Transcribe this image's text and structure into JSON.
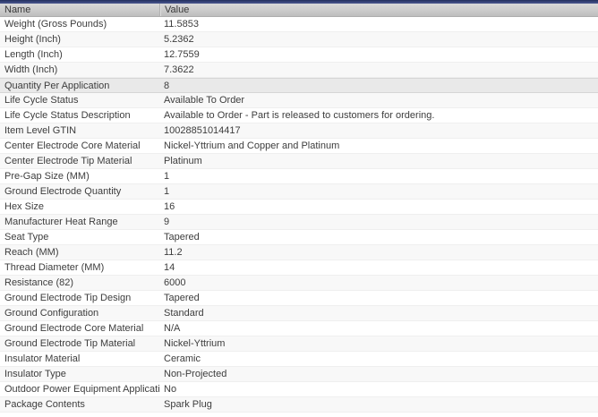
{
  "colors": {
    "topbar_dark": "#222f5e",
    "topbar_light": "#4a5790",
    "header_gradient_top": "#d8d8d8",
    "header_gradient_bottom": "#bdbdbd",
    "stripe": "#f8f8f8",
    "highlight": "#e9e9e9",
    "text": "#3d3d3d"
  },
  "table": {
    "columns": {
      "name": "Name",
      "value": "Value"
    },
    "selected_index": 4,
    "rows": [
      {
        "name": "Weight (Gross Pounds)",
        "value": "11.5853"
      },
      {
        "name": "Height (Inch)",
        "value": "5.2362"
      },
      {
        "name": "Length (Inch)",
        "value": "12.7559"
      },
      {
        "name": "Width (Inch)",
        "value": "7.3622"
      },
      {
        "name": "Quantity Per Application",
        "value": "8"
      },
      {
        "name": "Life Cycle Status",
        "value": "Available To Order"
      },
      {
        "name": "Life Cycle Status Description",
        "value": "Available to Order - Part is released to customers for ordering."
      },
      {
        "name": "Item Level GTIN",
        "value": "10028851014417"
      },
      {
        "name": "Center Electrode Core Material",
        "value": "Nickel-Yttrium and Copper and Platinum"
      },
      {
        "name": "Center Electrode Tip Material",
        "value": "Platinum"
      },
      {
        "name": "Pre-Gap Size (MM)",
        "value": "1"
      },
      {
        "name": "Ground Electrode Quantity",
        "value": "1"
      },
      {
        "name": "Hex Size",
        "value": "16"
      },
      {
        "name": "Manufacturer Heat Range",
        "value": "9"
      },
      {
        "name": "Seat Type",
        "value": "Tapered"
      },
      {
        "name": "Reach (MM)",
        "value": "11.2"
      },
      {
        "name": "Thread Diameter (MM)",
        "value": "14"
      },
      {
        "name": "Resistance (82)",
        "value": "6000"
      },
      {
        "name": "Ground Electrode Tip Design",
        "value": "Tapered"
      },
      {
        "name": "Ground Configuration",
        "value": "Standard"
      },
      {
        "name": "Ground Electrode Core Material",
        "value": "N/A"
      },
      {
        "name": "Ground Electrode Tip Material",
        "value": "Nickel-Yttrium"
      },
      {
        "name": "Insulator Material",
        "value": "Ceramic"
      },
      {
        "name": "Insulator Type",
        "value": "Non-Projected"
      },
      {
        "name": "Outdoor Power Equipment Application",
        "value": "No"
      },
      {
        "name": "Package Contents",
        "value": "Spark Plug"
      }
    ]
  }
}
